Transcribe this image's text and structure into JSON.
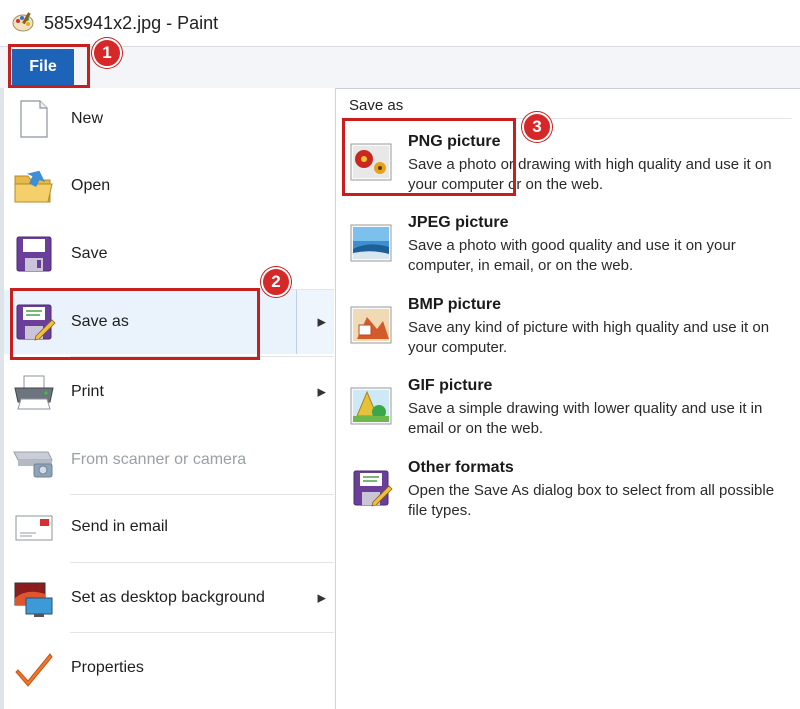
{
  "window": {
    "title": "585x941x2.jpg - Paint",
    "app_icon": "paint-palette-icon"
  },
  "ribbon": {
    "file_tab": "File"
  },
  "menu": {
    "items": [
      {
        "label": "New",
        "icon": "new-document-icon"
      },
      {
        "label": "Open",
        "icon": "open-folder-icon"
      },
      {
        "label": "Save",
        "icon": "floppy-disk-icon"
      },
      {
        "label": "Save as",
        "icon": "save-as-icon",
        "has_submenu": true
      },
      {
        "label": "Print",
        "icon": "printer-icon",
        "has_submenu": true
      },
      {
        "label": "From scanner or camera",
        "icon": "scanner-camera-icon",
        "disabled": true
      },
      {
        "label": "Send in email",
        "icon": "email-icon"
      },
      {
        "label": "Set as desktop background",
        "icon": "desktop-background-icon",
        "has_submenu": true
      },
      {
        "label": "Properties",
        "icon": "checkmark-icon"
      }
    ],
    "submenu_arrow": "▶"
  },
  "save_as": {
    "heading": "Save as",
    "formats": [
      {
        "title": "PNG picture",
        "description": "Save a photo or drawing with high quality and use it on your computer or on the web.",
        "icon": "png-picture-icon"
      },
      {
        "title": "JPEG picture",
        "description": "Save a photo with good quality and use it on your computer, in email, or on the web.",
        "icon": "jpeg-picture-icon"
      },
      {
        "title": "BMP picture",
        "description": "Save any kind of picture with high quality and use it on your computer.",
        "icon": "bmp-picture-icon"
      },
      {
        "title": "GIF picture",
        "description": "Save a simple drawing with lower quality and use it in email or on the web.",
        "icon": "gif-picture-icon"
      },
      {
        "title": "Other formats",
        "description": "Open the Save As dialog box to select from all possible file types.",
        "icon": "other-formats-icon"
      }
    ]
  },
  "annotations": {
    "badges": [
      "1",
      "2",
      "3"
    ],
    "highlight_color": "#c81e1e",
    "badge_color": "#d62828"
  },
  "colors": {
    "file_tab": "#1d64b8",
    "hover_bg": "#eaf2fb"
  }
}
